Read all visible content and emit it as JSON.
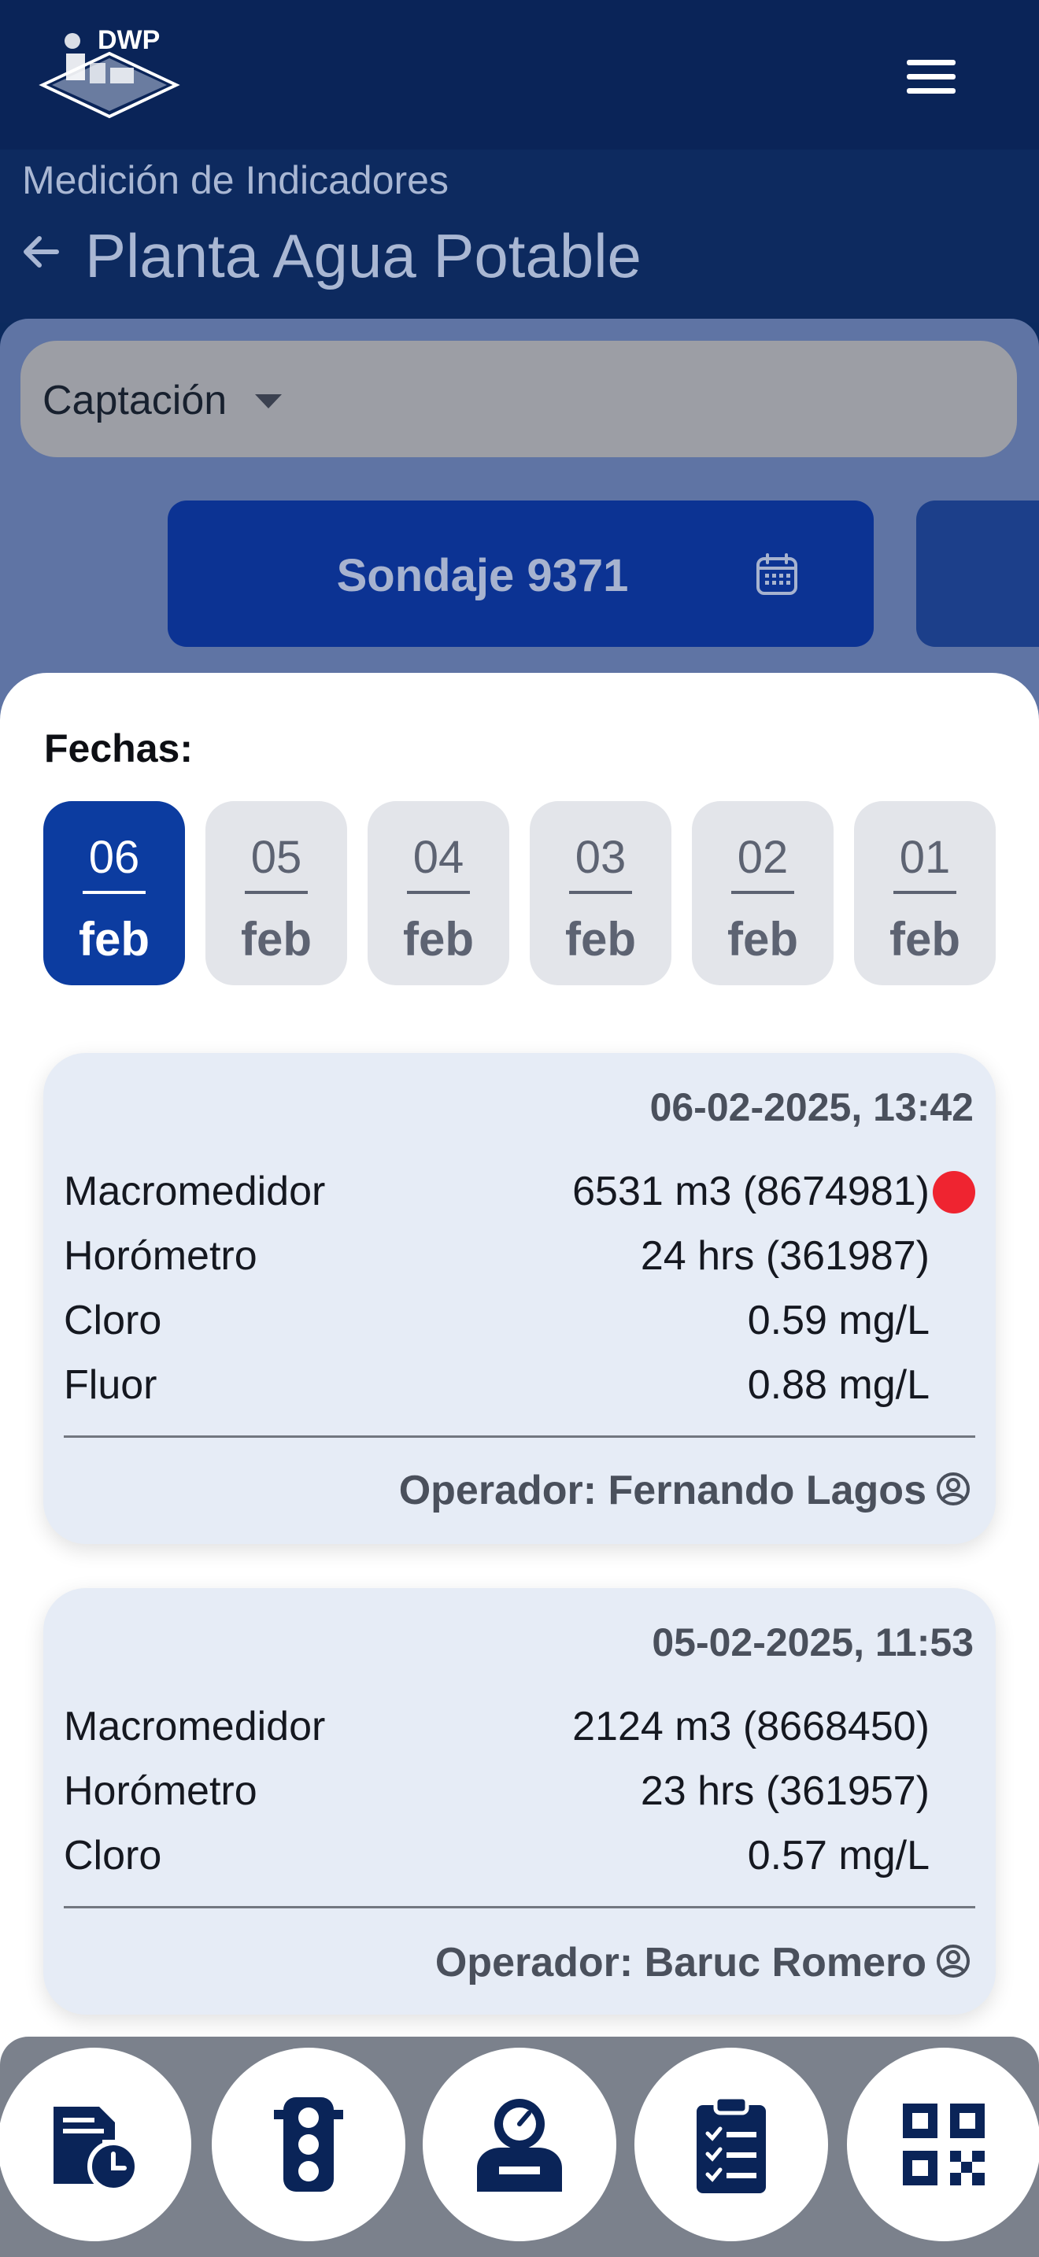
{
  "header": {
    "logo_text": "DWP",
    "menu_icon": "hamburger-menu-icon"
  },
  "breadcrumb": "Medición de Indicadores",
  "page_title": "Planta Agua Potable",
  "selector": {
    "value": "Captación"
  },
  "station": {
    "label": "Sondaje 9371",
    "icon": "calendar-icon"
  },
  "dates": {
    "label": "Fechas:",
    "items": [
      {
        "day": "06",
        "month": "feb",
        "active": true
      },
      {
        "day": "05",
        "month": "feb",
        "active": false
      },
      {
        "day": "04",
        "month": "feb",
        "active": false
      },
      {
        "day": "03",
        "month": "feb",
        "active": false
      },
      {
        "day": "02",
        "month": "feb",
        "active": false
      },
      {
        "day": "01",
        "month": "feb",
        "active": false
      }
    ]
  },
  "records": [
    {
      "datetime": "06-02-2025, 13:42",
      "rows": [
        {
          "label": "Macromedidor",
          "value": "6531 m3 (8674981)"
        },
        {
          "label": "Horómetro",
          "value": "24 hrs (361987)"
        },
        {
          "label": "Cloro",
          "value": "0.59 mg/L"
        },
        {
          "label": "Fluor",
          "value": "0.88 mg/L"
        }
      ],
      "status_color": "#ef2430",
      "operator": "Operador: Fernando Lagos"
    },
    {
      "datetime": "05-02-2025, 11:53",
      "rows": [
        {
          "label": "Macromedidor",
          "value": "2124 m3 (8668450)"
        },
        {
          "label": "Horómetro",
          "value": "23 hrs (361957)"
        },
        {
          "label": "Cloro",
          "value": "0.57 mg/L"
        }
      ],
      "operator": "Operador: Baruc Romero"
    }
  ],
  "bottom_nav": [
    {
      "icon": "document-clock-icon"
    },
    {
      "icon": "traffic-light-icon"
    },
    {
      "icon": "operator-gauge-icon"
    },
    {
      "icon": "clipboard-checklist-icon"
    },
    {
      "icon": "qr-code-icon"
    }
  ],
  "colors": {
    "primary": "#0c3ca0",
    "header": "#0a2458",
    "alert": "#ef2430"
  }
}
